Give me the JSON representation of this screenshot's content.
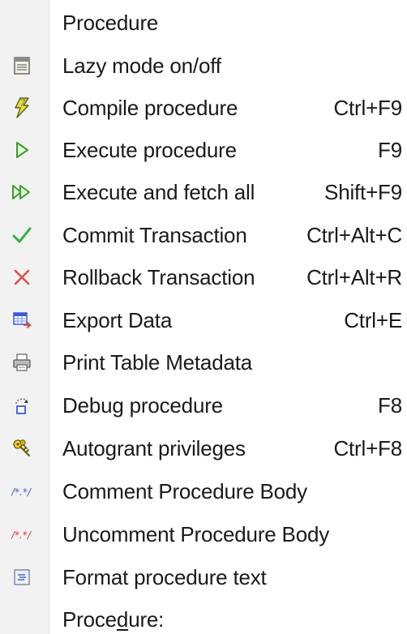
{
  "menu": {
    "header": "Procedure",
    "items": [
      {
        "label": "Lazy mode on/off",
        "shortcut": "",
        "icon": "lazy-mode-icon"
      },
      {
        "label": "Compile procedure",
        "shortcut": "Ctrl+F9",
        "icon": "compile-icon"
      },
      {
        "label": "Execute procedure",
        "shortcut": "F9",
        "icon": "execute-icon"
      },
      {
        "label": "Execute and fetch all",
        "shortcut": "Shift+F9",
        "icon": "execute-fetch-all-icon"
      },
      {
        "label": "Commit Transaction",
        "shortcut": "Ctrl+Alt+C",
        "icon": "commit-icon"
      },
      {
        "label": "Rollback Transaction",
        "shortcut": "Ctrl+Alt+R",
        "icon": "rollback-icon"
      },
      {
        "label": "Export Data",
        "shortcut": "Ctrl+E",
        "icon": "export-data-icon"
      },
      {
        "label": "Print Table Metadata",
        "shortcut": "",
        "icon": "print-icon"
      },
      {
        "label": "Debug procedure",
        "shortcut": "F8",
        "icon": "debug-icon"
      },
      {
        "label": "Autogrant privileges",
        "shortcut": "Ctrl+F8",
        "icon": "autogrant-keys-icon"
      },
      {
        "label": "Comment Procedure Body",
        "shortcut": "",
        "icon": "comment-icon"
      },
      {
        "label": "Uncomment Procedure Body",
        "shortcut": "",
        "icon": "uncomment-icon"
      },
      {
        "label": "Format procedure text",
        "shortcut": "",
        "icon": "format-text-icon"
      }
    ],
    "footer": {
      "before": "Proce",
      "accel": "d",
      "after": "ure:"
    }
  },
  "colors": {
    "gutter": "#f2f2f2",
    "execute_green": "#3a9b2e",
    "commit_green": "#3cb043",
    "rollback_red": "#d9534f",
    "comment_blue": "#3b5bd6",
    "uncomment_red": "#d93b3b",
    "keys_yellow": "#d8b40a"
  }
}
